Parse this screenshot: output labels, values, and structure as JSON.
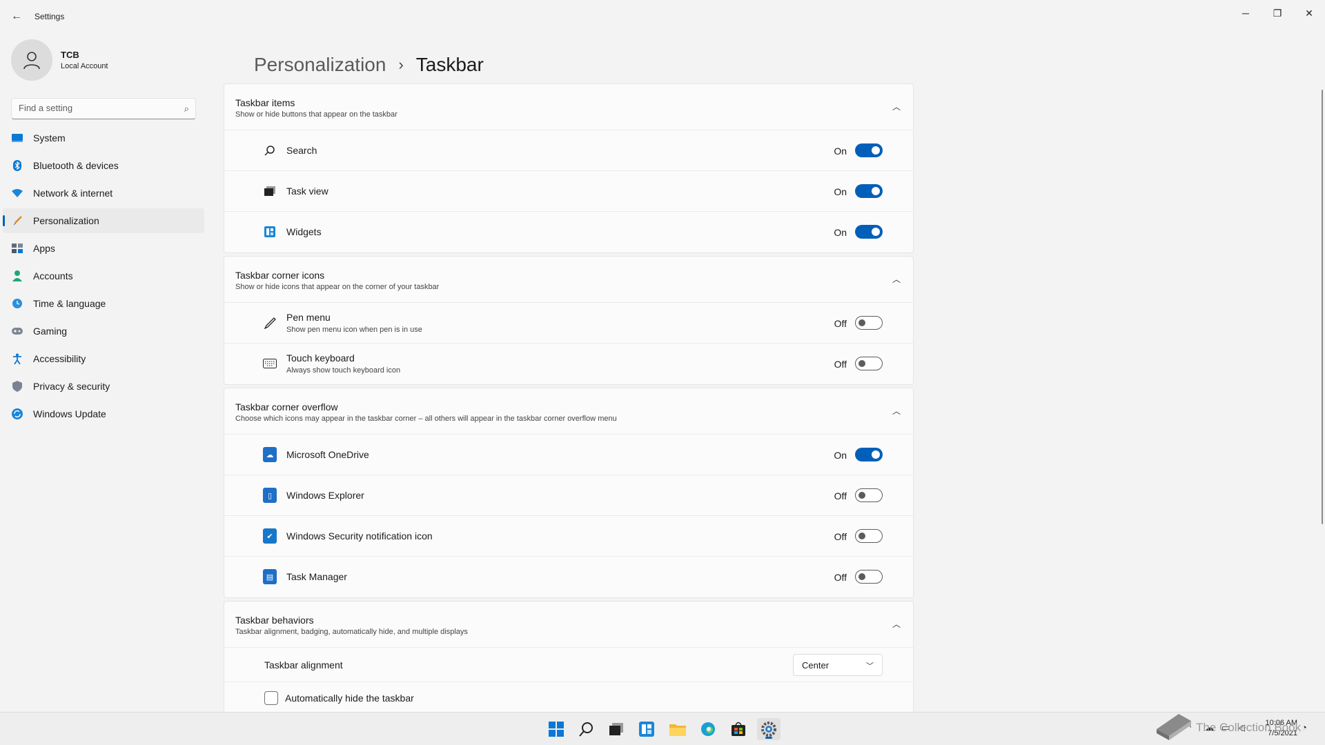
{
  "window": {
    "title": "Settings",
    "minimize": "─",
    "maximize": "❐",
    "close": "✕",
    "back": "←"
  },
  "profile": {
    "name": "TCB",
    "account_type": "Local Account"
  },
  "search": {
    "placeholder": "Find a setting"
  },
  "sidebar": {
    "items": [
      {
        "label": "System",
        "icon": "monitor-icon"
      },
      {
        "label": "Bluetooth & devices",
        "icon": "bluetooth-icon"
      },
      {
        "label": "Network & internet",
        "icon": "wifi-icon"
      },
      {
        "label": "Personalization",
        "icon": "brush-icon",
        "active": true
      },
      {
        "label": "Apps",
        "icon": "apps-icon"
      },
      {
        "label": "Accounts",
        "icon": "person-icon"
      },
      {
        "label": "Time & language",
        "icon": "globe-clock-icon"
      },
      {
        "label": "Gaming",
        "icon": "gamepad-icon"
      },
      {
        "label": "Accessibility",
        "icon": "accessibility-icon"
      },
      {
        "label": "Privacy & security",
        "icon": "shield-icon"
      },
      {
        "label": "Windows Update",
        "icon": "update-icon"
      }
    ]
  },
  "breadcrumb": {
    "parent": "Personalization",
    "separator": "›",
    "current": "Taskbar"
  },
  "sections": {
    "taskbar_items": {
      "title": "Taskbar items",
      "description": "Show or hide buttons that appear on the taskbar",
      "rows": [
        {
          "label": "Search",
          "state": "On",
          "on": true,
          "icon": "search-icon"
        },
        {
          "label": "Task view",
          "state": "On",
          "on": true,
          "icon": "task-view-icon"
        },
        {
          "label": "Widgets",
          "state": "On",
          "on": true,
          "icon": "widgets-icon"
        }
      ]
    },
    "corner_icons": {
      "title": "Taskbar corner icons",
      "description": "Show or hide icons that appear on the corner of your taskbar",
      "rows": [
        {
          "label": "Pen menu",
          "sub": "Show pen menu icon when pen is in use",
          "state": "Off",
          "on": false,
          "icon": "pen-icon"
        },
        {
          "label": "Touch keyboard",
          "sub": "Always show touch keyboard icon",
          "state": "Off",
          "on": false,
          "icon": "keyboard-icon"
        }
      ]
    },
    "corner_overflow": {
      "title": "Taskbar corner overflow",
      "description": "Choose which icons may appear in the taskbar corner – all others will appear in the taskbar corner overflow menu",
      "rows": [
        {
          "label": "Microsoft OneDrive",
          "state": "On",
          "on": true,
          "icon": "onedrive-icon"
        },
        {
          "label": "Windows Explorer",
          "state": "Off",
          "on": false,
          "icon": "explorer-icon"
        },
        {
          "label": "Windows Security notification icon",
          "state": "Off",
          "on": false,
          "icon": "security-icon"
        },
        {
          "label": "Task Manager",
          "state": "Off",
          "on": false,
          "icon": "task-manager-icon"
        }
      ]
    },
    "behaviors": {
      "title": "Taskbar behaviors",
      "description": "Taskbar alignment, badging, automatically hide, and multiple displays",
      "alignment_label": "Taskbar alignment",
      "alignment_value": "Center",
      "autohide_label": "Automatically hide the taskbar",
      "autohide_checked": false
    }
  },
  "taskbar": {
    "apps": [
      "start-icon",
      "search-icon",
      "task-view-icon",
      "widgets-icon",
      "file-explorer-icon",
      "edge-icon",
      "store-icon",
      "settings-icon"
    ],
    "clock_time": "10:06 AM",
    "clock_date": "7/5/2021"
  },
  "watermark": {
    "text": "The Collection Book"
  },
  "colors": {
    "accent": "#005fb8",
    "background": "#f3f3f3",
    "card": "#fbfbfb"
  }
}
